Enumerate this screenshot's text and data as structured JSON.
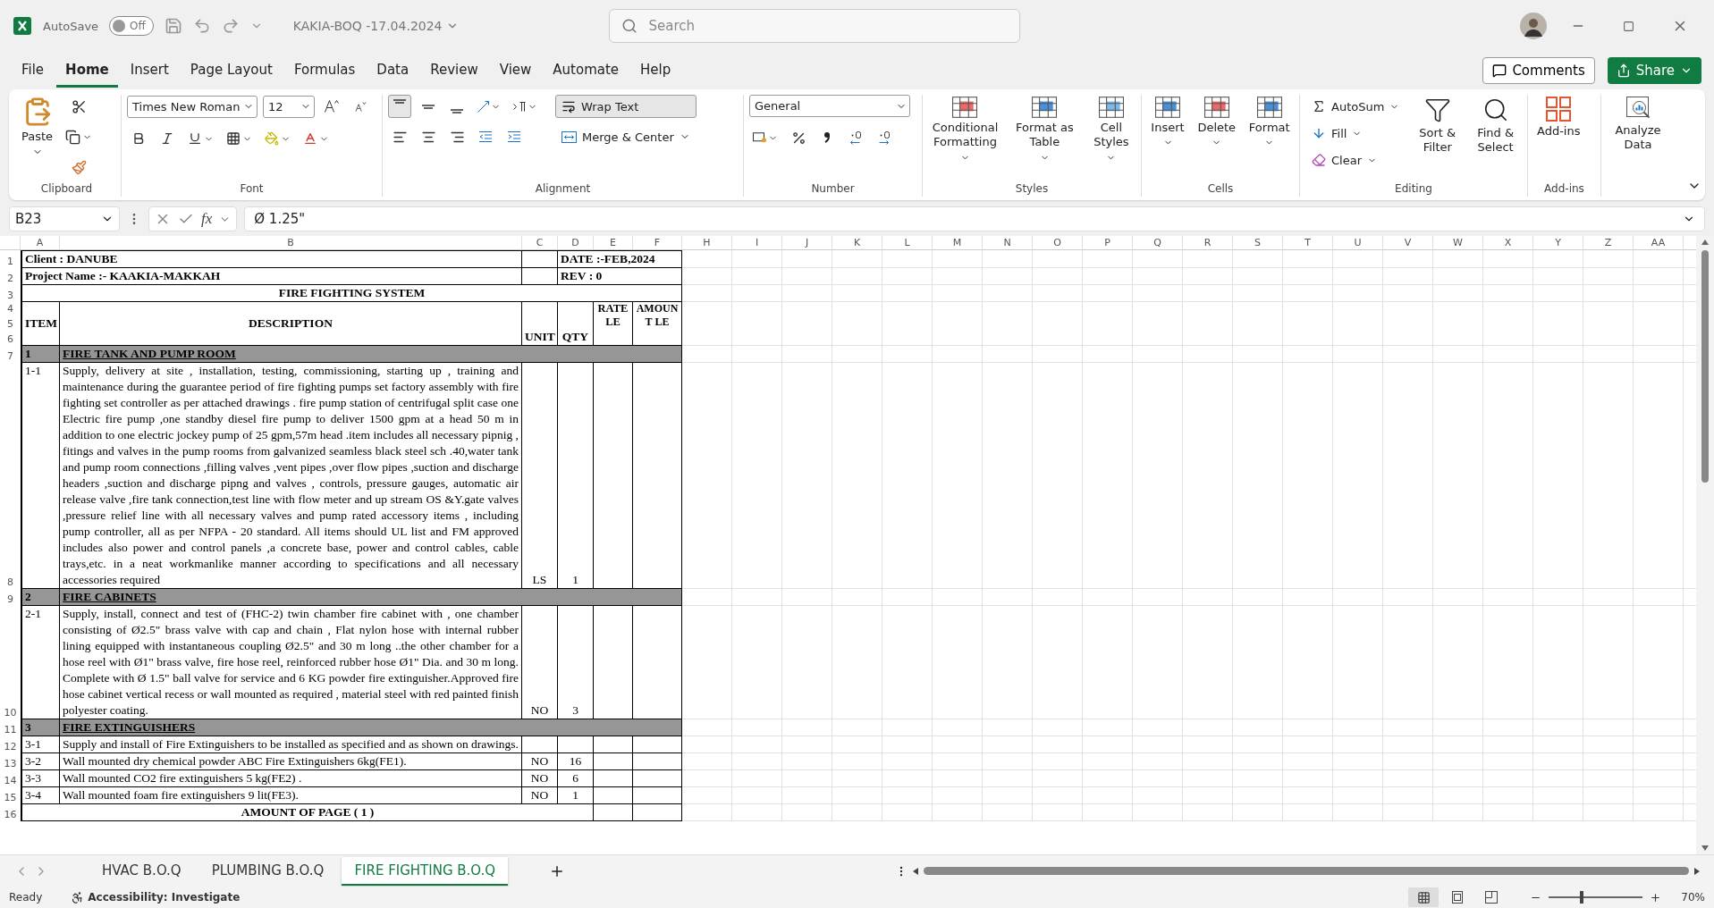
{
  "title_bar": {
    "autosave": {
      "label": "AutoSave",
      "state_label": "Off",
      "on": false
    },
    "document_title": "KAKIA-BOQ -17.04.2024",
    "search": {
      "placeholder": "Search"
    }
  },
  "menu_tabs": [
    {
      "label": "File",
      "selected": false
    },
    {
      "label": "Home",
      "selected": true
    },
    {
      "label": "Insert",
      "selected": false
    },
    {
      "label": "Page Layout",
      "selected": false
    },
    {
      "label": "Formulas",
      "selected": false
    },
    {
      "label": "Data",
      "selected": false
    },
    {
      "label": "Review",
      "selected": false
    },
    {
      "label": "View",
      "selected": false
    },
    {
      "label": "Automate",
      "selected": false
    },
    {
      "label": "Help",
      "selected": false
    }
  ],
  "share_bar": {
    "comments": "Comments",
    "share": "Share"
  },
  "ribbon": {
    "clipboard": {
      "paste": "Paste",
      "group_label": "Clipboard"
    },
    "font": {
      "font_name": "Times New Roman",
      "font_size": "12",
      "group_label": "Font"
    },
    "alignment": {
      "vertical_align": [
        {
          "selected": true
        },
        {
          "selected": false
        },
        {
          "selected": false
        }
      ],
      "wrap_text": {
        "label": "Wrap Text",
        "on": true
      },
      "merge": "Merge & Center",
      "group_label": "Alignment"
    },
    "number": {
      "format": "General",
      "group_label": "Number"
    },
    "styles": {
      "buttons": [
        "Conditional Formatting",
        "Format as Table",
        "Cell Styles"
      ],
      "group_label": "Styles"
    },
    "cells": {
      "buttons": [
        "Insert",
        "Delete",
        "Format"
      ],
      "group_label": "Cells"
    },
    "editing": {
      "small": [
        "AutoSum",
        "Fill",
        "Clear"
      ],
      "large": [
        "Sort & Filter",
        "Find & Select"
      ],
      "group_label": "Editing"
    },
    "addins": {
      "button": "Add-ins",
      "group_label": "Add-ins"
    },
    "analyze": {
      "button": "Analyze Data"
    }
  },
  "formula_bar": {
    "name_box": "B23",
    "fx": "fx",
    "formula": "Ø 1.25\""
  },
  "sheet": {
    "columns": [
      "A",
      "B",
      "C",
      "D",
      "E",
      "F",
      "H",
      "I",
      "J",
      "K",
      "L",
      "M",
      "N",
      "O",
      "P",
      "Q",
      "R",
      "S",
      "T",
      "U",
      "V",
      "W",
      "X",
      "Y",
      "Z",
      "AA"
    ],
    "rows": [
      {
        "kind": "info",
        "numbers": [
          "1"
        ],
        "left": "Client : DANUBE",
        "right": "DATE :-FEB,2024"
      },
      {
        "kind": "info",
        "numbers": [
          "2"
        ],
        "left": "Project Name :- KAAKIA-MAKKAH",
        "right": "REV : 0"
      },
      {
        "kind": "title",
        "numbers": [
          "3"
        ],
        "text": "FIRE FIGHTING SYSTEM"
      },
      {
        "kind": "header",
        "numbers": [
          "4",
          "5",
          "6"
        ],
        "item": "ITEM",
        "description": "DESCRIPTION",
        "unit": "UNIT",
        "qty": "QTY",
        "rate": "RATE LE",
        "amount": "AMOUNT LE"
      },
      {
        "kind": "section",
        "numbers": [
          "7"
        ],
        "item": "1",
        "description": "FIRE TANK AND PUMP ROOM"
      },
      {
        "kind": "item",
        "numbers": [
          "8"
        ],
        "item": "1-1",
        "description": "Supply, delivery at site , installation, testing, commissioning, starting up , training and maintenance during the guarantee period of fire fighting pumps set factory assembly with fire fighting set controller as per attached drawings . fire pump station of centrifugal split case one Electric fire pump ,one standby diesel fire pump to deliver 1500 gpm at a head 50 m in addition to one electric jockey pump of 25 gpm,57m head .item includes all necessary pipnig , fitings and valves in the pump rooms from galvanized seamless black steel sch .40,water tank and pump room connections ,filling valves ,vent pipes ,over flow pipes ,suction and discharge headers ,suction and discharge pipng and valves , controls, pressure gauges, automatic air release valve ,fire tank connection,test line with flow meter and up stream OS &Y.gate valves ,pressure relief line with all necessary valves and pump rated accessory items , including pump controller, all as per NFPA - 20 standard. All items should UL list and FM approved includes also power and control panels ,a concrete base, power and control cables, cable trays,etc. in a neat workmanlike manner according to specifications and all necessary accessories required",
        "unit": "LS",
        "qty": "1"
      },
      {
        "kind": "section",
        "numbers": [
          "9"
        ],
        "item": "2",
        "description": "FIRE CABINETS"
      },
      {
        "kind": "item",
        "numbers": [
          "10"
        ],
        "item": "2-1",
        "description": "Supply, install, connect and test of (FHC-2) twin chamber fire cabinet with , one chamber consisting of Ø2.5\" brass valve with cap and chain , Flat nylon hose with internal rubber lining equipped with instantaneous coupling Ø2.5\" and 30 m long ..the other chamber for a hose reel with Ø1\" brass valve, fire hose reel, reinforced rubber hose Ø1\" Dia. and 30 m long. Complete with Ø 1.5\" ball valve for service and 6 KG powder fire extinguisher.Approved fire hose cabinet vertical recess or wall mounted as required , material steel with red painted finish polyester coating.",
        "unit": "NO",
        "qty": "3"
      },
      {
        "kind": "section",
        "numbers": [
          "11"
        ],
        "item": "3",
        "description": "FIRE EXTINGUISHERS"
      },
      {
        "kind": "item",
        "numbers": [
          "12"
        ],
        "item": "3-1",
        "description": "Supply and install of Fire Extinguishers to be installed as specified and as shown on drawings."
      },
      {
        "kind": "item",
        "numbers": [
          "13"
        ],
        "item": "3-2",
        "description": "Wall mounted dry chemical powder ABC Fire Extinguishers 6kg(FE1).",
        "unit": "NO",
        "qty": "16"
      },
      {
        "kind": "item",
        "numbers": [
          "14"
        ],
        "item": "3-3",
        "description": "Wall mounted CO2 fire extinguishers 5 kg(FE2) .",
        "unit": "NO",
        "qty": "6"
      },
      {
        "kind": "item",
        "numbers": [
          "15"
        ],
        "item": "3-4",
        "description": "Wall mounted foam fire extinguishers 9 lit(FE3).",
        "unit": "NO",
        "qty": "1"
      },
      {
        "kind": "total",
        "numbers": [
          "16"
        ],
        "text": "AMOUNT OF PAGE ( 1 )"
      }
    ],
    "tabs": [
      {
        "label": "HVAC B.O.Q",
        "selected": false
      },
      {
        "label": "PLUMBING B.O.Q",
        "selected": false
      },
      {
        "label": "FIRE FIGHTING B.O.Q",
        "selected": true
      }
    ]
  },
  "status_bar": {
    "ready": "Ready",
    "accessibility": "Accessibility: Investigate",
    "views": [
      {
        "selected": true
      },
      {
        "selected": false
      },
      {
        "selected": false
      }
    ],
    "zoom": {
      "level": 0.35,
      "reading": "70%"
    }
  }
}
